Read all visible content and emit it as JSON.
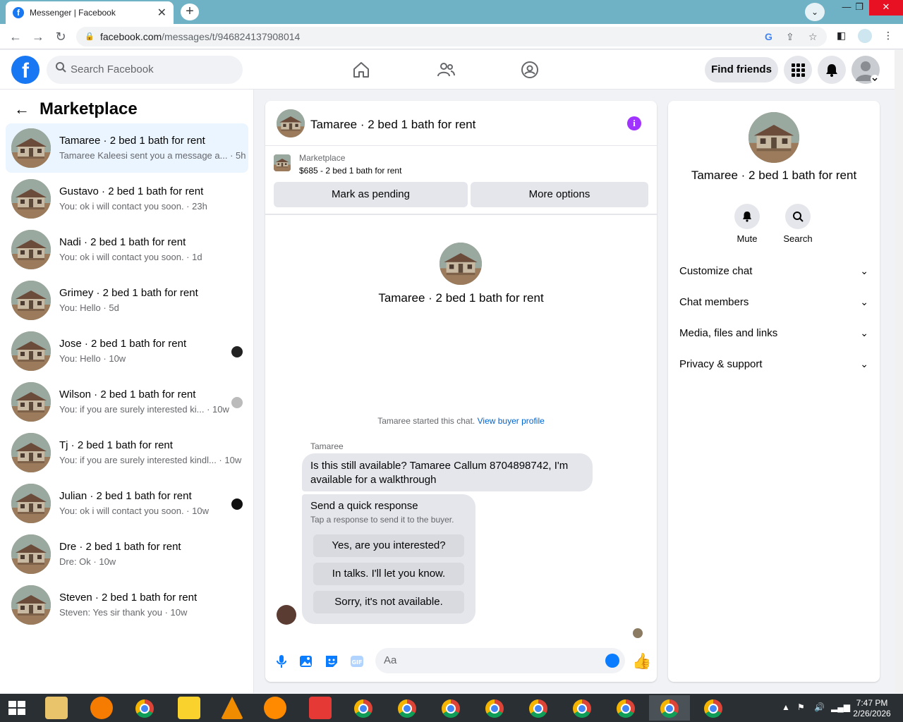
{
  "browser": {
    "tab_title": "Messenger | Facebook",
    "url_host": "facebook.com",
    "url_path": "/messages/t/946824137908014"
  },
  "fb": {
    "search_placeholder": "Search Facebook",
    "find_friends": "Find friends"
  },
  "left": {
    "title": "Marketplace",
    "conversations": [
      {
        "name": "Tamaree · 2 bed 1 bath for rent",
        "preview": "Tamaree Kaleesi sent you a message a... · 5h"
      },
      {
        "name": "Gustavo · 2 bed 1 bath for rent",
        "preview": "You: ok i will contact you soon. · 23h"
      },
      {
        "name": "Nadi · 2 bed 1 bath for rent",
        "preview": "You: ok i will contact you soon. · 1d"
      },
      {
        "name": "Grimey · 2 bed 1 bath for rent",
        "preview": "You: Hello · 5d"
      },
      {
        "name": "Jose · 2 bed 1 bath for rent",
        "preview": "You: Hello · 10w"
      },
      {
        "name": "Wilson · 2 bed 1 bath for rent",
        "preview": "You: if you are surely interested ki... · 10w"
      },
      {
        "name": "Tj · 2 bed 1 bath for rent",
        "preview": "You: if you are surely interested kindl... · 10w"
      },
      {
        "name": "Julian · 2 bed 1 bath for rent",
        "preview": "You: ok i will contact you soon. · 10w"
      },
      {
        "name": "Dre · 2 bed 1 bath for rent",
        "preview": "Dre: Ok · 10w"
      },
      {
        "name": "Steven · 2 bed 1 bath for rent",
        "preview": "Steven: Yes sir thank you · 10w"
      }
    ]
  },
  "chat": {
    "title": "Tamaree · 2 bed 1 bath for rent",
    "marketplace_label": "Marketplace",
    "listing": "$685 - 2 bed 1 bath for rent",
    "mark_pending": "Mark as pending",
    "more_options": "More options",
    "intro_title": "Tamaree · 2 bed 1 bath for rent",
    "started_text": "Tamaree started this chat.",
    "view_buyer": "View buyer profile",
    "sender": "Tamaree",
    "message": "Is this still available? Tamaree Callum 8704898742, I'm available for a walkthrough",
    "quick_title": "Send a quick response",
    "quick_sub": "Tap a response to send it to the buyer.",
    "quick_responses": [
      "Yes, are you interested?",
      "In talks. I'll let you know.",
      "Sorry, it's not available."
    ],
    "input_placeholder": "Aa"
  },
  "right": {
    "title": "Tamaree · 2 bed 1 bath for rent",
    "mute": "Mute",
    "search": "Search",
    "sections": [
      "Customize chat",
      "Chat members",
      "Media, files and links",
      "Privacy & support"
    ]
  },
  "taskbar": {
    "time": "7:47 PM",
    "date": "2/26/2026"
  }
}
